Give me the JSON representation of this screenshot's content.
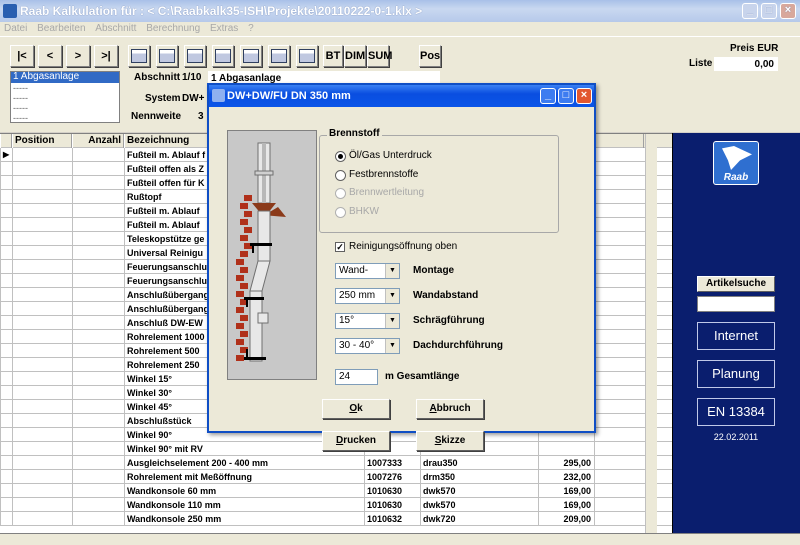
{
  "window": {
    "title": "Raab Kalkulation für : < C:\\Raabkalk35-ISH\\Projekte\\20110222-0-1.klx >",
    "min": "_",
    "max": "□",
    "close": "×"
  },
  "menu": [
    "Datei",
    "Bearbeiten",
    "Abschnitt",
    "Berechnung",
    "Extras",
    "?"
  ],
  "toolbar": {
    "nav": [
      "|<",
      "<",
      ">",
      ">|"
    ],
    "text_buttons": [
      "BT",
      "DIM",
      "SUM",
      "Pos"
    ]
  },
  "header": {
    "sections": [
      "1 Abgasanlage",
      "-----",
      "-----",
      "-----",
      "-----"
    ],
    "abschnitt_label": "Abschnitt",
    "abschnitt_value": "1/10",
    "abschnitt_name": "1 Abgasanlage",
    "system_label": "System",
    "system_value": "DW+",
    "nennweite_label": "Nennweite",
    "nennweite_value": "3",
    "price_label": "Preis EUR",
    "liste_label": "Liste",
    "liste_value": "0,00"
  },
  "table": {
    "columns": [
      "Position",
      "Anzahl",
      "Bezeichnung"
    ],
    "rows": [
      {
        "name": "Fußteil m. Ablauf f",
        "art": "",
        "code": "",
        "price": ""
      },
      {
        "name": "Fußteil offen als Z",
        "art": "",
        "code": "",
        "price": ""
      },
      {
        "name": "Fußteil offen für K",
        "art": "",
        "code": "",
        "price": ""
      },
      {
        "name": "Rußtopf",
        "art": "",
        "code": "",
        "price": ""
      },
      {
        "name": "Fußteil m. Ablauf",
        "art": "",
        "code": "",
        "price": ""
      },
      {
        "name": "Fußteil m. Ablauf",
        "art": "",
        "code": "",
        "price": ""
      },
      {
        "name": "Teleskopstütze ge",
        "art": "",
        "code": "",
        "price": ""
      },
      {
        "name": "Universal Reinigu",
        "art": "",
        "code": "",
        "price": ""
      },
      {
        "name": "Feuerungsanschlu",
        "art": "",
        "code": "",
        "price": ""
      },
      {
        "name": "Feuerungsanschlu",
        "art": "",
        "code": "",
        "price": ""
      },
      {
        "name": "Anschlußübergang",
        "art": "",
        "code": "",
        "price": ""
      },
      {
        "name": "Anschlußübergang",
        "art": "",
        "code": "",
        "price": ""
      },
      {
        "name": "Anschluß DW-EW",
        "art": "",
        "code": "",
        "price": ""
      },
      {
        "name": "Rohrelement 1000",
        "art": "",
        "code": "",
        "price": ""
      },
      {
        "name": "Rohrelement 500",
        "art": "",
        "code": "",
        "price": ""
      },
      {
        "name": "Rohrelement 250",
        "art": "",
        "code": "",
        "price": ""
      },
      {
        "name": "Winkel 15°",
        "art": "",
        "code": "",
        "price": ""
      },
      {
        "name": "Winkel 30°",
        "art": "",
        "code": "",
        "price": ""
      },
      {
        "name": "Winkel 45°",
        "art": "",
        "code": "",
        "price": ""
      },
      {
        "name": "Abschlußstück",
        "art": "",
        "code": "",
        "price": ""
      },
      {
        "name": "Winkel 90°",
        "art": "",
        "code": "",
        "price": ""
      },
      {
        "name": "Winkel 90° mit RV",
        "art": "",
        "code": "",
        "price": ""
      },
      {
        "name": "Ausgleichselement 200 - 400 mm",
        "art": "1007333",
        "code": "drau350",
        "price": "295,00"
      },
      {
        "name": "Rohrelement mit Meßöffnung",
        "art": "1007276",
        "code": "drm350",
        "price": "232,00"
      },
      {
        "name": "Wandkonsole 60 mm",
        "art": "1010630",
        "code": "dwk570",
        "price": "169,00"
      },
      {
        "name": "Wandkonsole 110 mm",
        "art": "1010630",
        "code": "dwk570",
        "price": "169,00"
      },
      {
        "name": "Wandkonsole 250 mm",
        "art": "1010632",
        "code": "dwk720",
        "price": "209,00"
      }
    ]
  },
  "side_panel": {
    "logo_text": "Raab",
    "artikelsuche": "Artikelsuche",
    "internet": "Internet",
    "planung": "Planung",
    "norm": "EN 13384",
    "date": "22.02.2011"
  },
  "dialog": {
    "title": "DW+DW/FU DN 350 mm",
    "brennstoff_label": "Brennstoff",
    "fuel_options": [
      {
        "label": "Öl/Gas Unterdruck",
        "state": "selected"
      },
      {
        "label": "Festbrennstoffe",
        "state": "enabled"
      },
      {
        "label": "Brennwertleitung",
        "state": "disabled"
      },
      {
        "label": "BHKW",
        "state": "disabled"
      }
    ],
    "reinigung_label": "Reinigungsöffnung oben",
    "reinigung_checked": true,
    "montage_value": "Wand-",
    "montage_label": "Montage",
    "wandabstand_value": "250 mm",
    "wandabstand_label": "Wandabstand",
    "schraeg_value": "15°",
    "schraeg_label": "Schrägführung",
    "dach_value": "30 - 40°",
    "dach_label": "Dachdurchführung",
    "laenge_value": "24",
    "laenge_label": "m Gesamtlänge",
    "ok": "Ok",
    "abbruch": "Abbruch",
    "drucken": "Drucken",
    "skizze": "Skizze"
  }
}
